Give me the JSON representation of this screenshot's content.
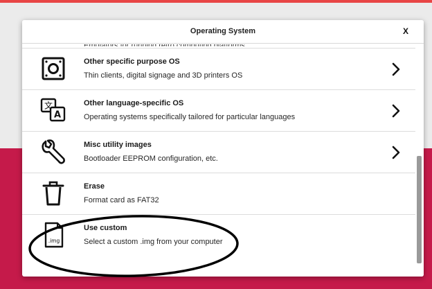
{
  "dialog": {
    "title": "Operating System",
    "close_label": "X"
  },
  "rows": [
    {
      "title": "",
      "description": "Emulators for running retro computing platforms",
      "icon": "gamepad-icon",
      "has_chevron": false
    },
    {
      "title": "Other specific purpose OS",
      "description": "Thin clients, digital signage and 3D printers OS",
      "icon": "square-target-icon",
      "has_chevron": true
    },
    {
      "title": "Other language-specific OS",
      "description": "Operating systems specifically tailored for particular languages",
      "icon": "language-icon",
      "has_chevron": true
    },
    {
      "title": "Misc utility images",
      "description": "Bootloader EEPROM configuration, etc.",
      "icon": "wrench-icon",
      "has_chevron": true
    },
    {
      "title": "Erase",
      "description": "Format card as FAT32",
      "icon": "trash-icon",
      "has_chevron": false
    },
    {
      "title": "Use custom",
      "description": "Select a custom .img from your computer",
      "icon": "img-file-icon",
      "icon_label": ".img",
      "has_chevron": false
    }
  ],
  "annotation_icon": "ellipse-highlight",
  "colors": {
    "accent": "#c51a4a",
    "top_bar": "#e84545",
    "scroll_thumb": "#9a9a9a"
  }
}
